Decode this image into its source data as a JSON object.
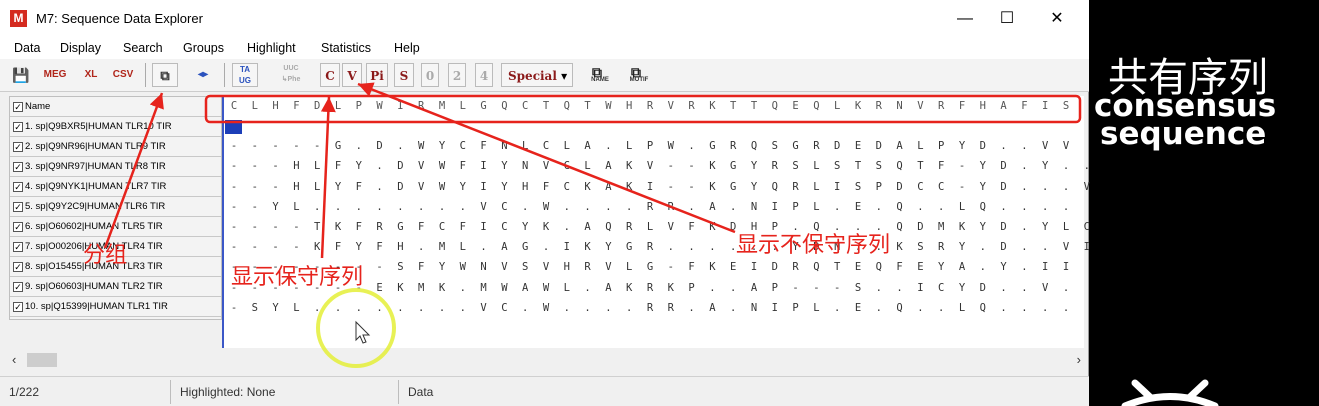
{
  "window": {
    "title": "M7: Sequence Data Explorer",
    "app_icon_letter": "M",
    "controls": {
      "minimize": "—",
      "maximize": "☐",
      "close": "✕"
    }
  },
  "menu": [
    "Data",
    "Display",
    "Search",
    "Groups",
    "Highlight",
    "Statistics",
    "Help"
  ],
  "toolbar": {
    "save": "💾",
    "meg": "MEG",
    "xl": "XL",
    "csv": "CSV",
    "copy": "⧉",
    "group": "◂▸",
    "translate": "TA\nUG",
    "translate_disabled": "UUC\n↳Phe",
    "c": "C",
    "v": "V",
    "pi": "Pi",
    "s": "S",
    "n0": "0",
    "n2": "2",
    "n4": "4",
    "special": "Special",
    "special_arrow": "▾",
    "find_name": "NAME",
    "find_motif": "MOTIF"
  },
  "header": {
    "name_label": "Name",
    "consensus": [
      "C",
      "L",
      "H",
      "F",
      "D",
      "L",
      "P",
      "W",
      "I",
      "R",
      "M",
      "L",
      "G",
      "Q",
      "C",
      "T",
      "Q",
      "T",
      "W",
      "H",
      "R",
      "V",
      "R",
      "K",
      "T",
      "T",
      "Q",
      "E",
      "Q",
      "L",
      "K",
      "R",
      "N",
      "V",
      "R",
      "F",
      "H",
      "A",
      "F",
      "I",
      "S"
    ]
  },
  "sequences": [
    {
      "name": "1. sp|Q9BXR5|HUMAN TLR10 TIR",
      "residues": ""
    },
    {
      "name": "2. sp|Q9NR96|HUMAN TLR9 TIR",
      "residues": "-----G.D.WYCFNLCLA.LPW.GRQSGRDEDALPYD..VV"
    },
    {
      "name": "3. sp|Q9NR97|HUMAN TLR8 TIR",
      "residues": "---HLFY.DVWFIYNVCLAKV--KGYRSLSTSQTF-YD.Y.."
    },
    {
      "name": "4. sp|Q9NYK1|HUMAN TLR7 TIR",
      "residues": "---HLYF.DVWYIYHFCKAKI--KGYQRLISPDCC-YD...V"
    },
    {
      "name": "5. sp|Q9Y2C9|HUMAN TLR6 TIR",
      "residues": "--YL........VC.W....RR.A.NIPL.E.Q..LQ...."
    },
    {
      "name": "6. sp|O60602|HUMAN TLR5 TIR",
      "residues": "----TKFRGFCFICYK.AQRLVFKDHP.Q...QDMKYD.YLC"
    },
    {
      "name": "7. sp|O00206|HUMAN TLR4 TIR",
      "residues": "----KFYFH.ML.AG.IKYGR......YDN..KSRY.D..VI"
    },
    {
      "name": "8. sp|O15455|HUMAN TLR3 TIR",
      "residues": "--------SFYWNVSVHRVLG-FKEIDRQTEQFEYA.Y.II"
    },
    {
      "name": "9. sp|O60603|HUMAN TLR2 TIR",
      "residues": "-------EKMK.MWAWL.AKRKP..AP---S..ICYD..V."
    },
    {
      "name": "10. sp|Q15399|HUMAN TLR1 TIR",
      "residues": "-SYL........VC.W....RR.A.NIPL.E.Q..LQ...."
    }
  ],
  "status": {
    "position": "1/222",
    "highlighted": "Highlighted: None",
    "mode": "Data"
  },
  "annotations": {
    "group": "分组",
    "conserved": "显示保守序列",
    "variable": "显示不保守序列"
  },
  "overlay": {
    "consensus_zh": "共有序列",
    "consensus_en1": "consensus",
    "consensus_en2": "sequence"
  },
  "colors": {
    "annotation_red": "#e6231c",
    "cursor_blue": "#1c3eb8",
    "title_icon_red": "#d42a1f"
  }
}
